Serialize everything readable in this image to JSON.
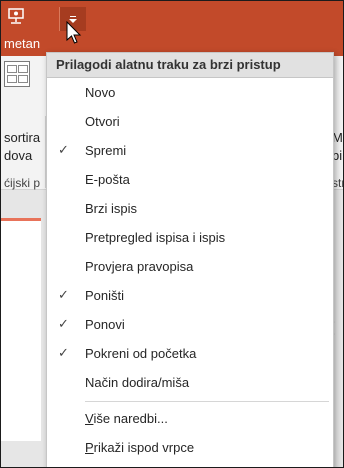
{
  "app": {
    "tab_partial": "metan",
    "accent": "#c24a2a"
  },
  "ribbon": {
    "btn_line1": "sortira",
    "btn_line2": "dova",
    "group_partial": "ćijski p",
    "right_line1": "M",
    "right_line2": "bi",
    "right_line3": "str"
  },
  "menu": {
    "title": "Prilagodi alatnu traku za brzi pristup",
    "items": [
      {
        "label": "Novo",
        "checked": false
      },
      {
        "label": "Otvori",
        "checked": false
      },
      {
        "label": "Spremi",
        "checked": true
      },
      {
        "label": "E-pošta",
        "checked": false
      },
      {
        "label": "Brzi ispis",
        "checked": false
      },
      {
        "label": "Pretpregled ispisa i ispis",
        "checked": false
      },
      {
        "label": "Provjera pravopisa",
        "checked": false
      },
      {
        "label": "Poništi",
        "checked": true
      },
      {
        "label": "Ponovi",
        "checked": true
      },
      {
        "label": "Pokreni od početka",
        "checked": true
      },
      {
        "label": "Način dodira/miša",
        "checked": false
      }
    ],
    "more_commands": {
      "accel": "V",
      "rest": "iše naredbi..."
    },
    "show_below": {
      "accel": "P",
      "rest": "rikaži ispod vrpce"
    },
    "check_glyph": "✓"
  },
  "workspace": {
    "dash_text": "- -"
  }
}
